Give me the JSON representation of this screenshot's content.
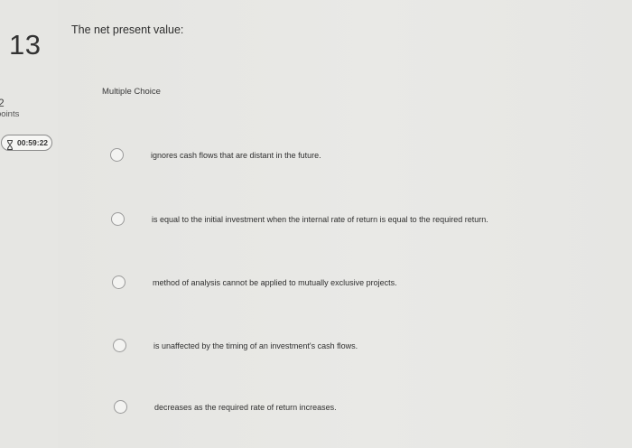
{
  "question": {
    "number": "13",
    "text": "The net present value:",
    "points_value": "2",
    "points_label": "points",
    "timer": "00:59:22",
    "timer_icon": "hourglass-icon",
    "type": "Multiple Choice"
  },
  "options": [
    {
      "label": "ignores cash flows that are distant in the future."
    },
    {
      "label": "is equal to the initial investment when the internal rate of return is equal to the required return."
    },
    {
      "label": "method of analysis cannot be applied to mutually exclusive projects."
    },
    {
      "label": "is unaffected by the timing of an investment's cash flows."
    },
    {
      "label": "decreases as the required rate of return increases."
    }
  ]
}
